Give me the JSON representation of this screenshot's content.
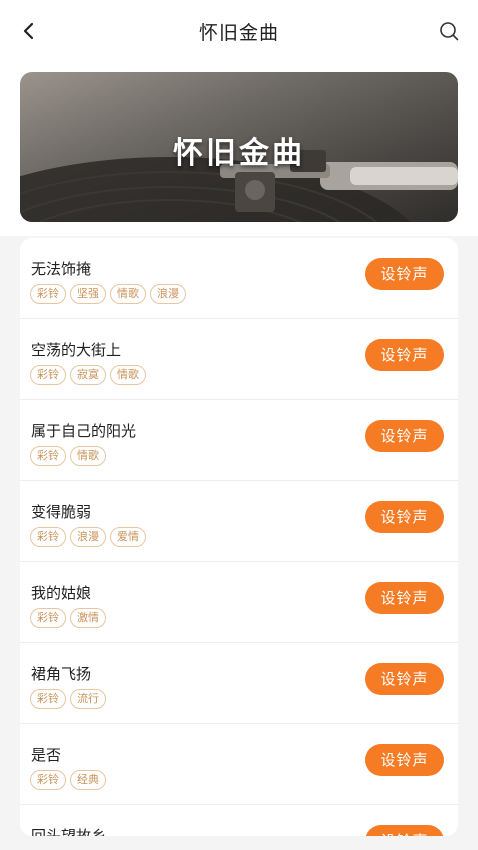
{
  "header": {
    "title": "怀旧金曲",
    "back_icon": "chevron-left-icon",
    "search_icon": "search-icon"
  },
  "banner": {
    "title": "怀旧金曲"
  },
  "colors": {
    "accent": "#f57c25",
    "tag_text": "#c9935a",
    "tag_border": "#e6c6a2"
  },
  "songs": [
    {
      "title": "无法饰掩",
      "tags": [
        "彩铃",
        "坚强",
        "情歌",
        "浪漫"
      ],
      "action": "设铃声"
    },
    {
      "title": "空荡的大街上",
      "tags": [
        "彩铃",
        "寂寞",
        "情歌"
      ],
      "action": "设铃声"
    },
    {
      "title": "属于自己的阳光",
      "tags": [
        "彩铃",
        "情歌"
      ],
      "action": "设铃声"
    },
    {
      "title": "变得脆弱",
      "tags": [
        "彩铃",
        "浪漫",
        "爱情"
      ],
      "action": "设铃声"
    },
    {
      "title": "我的姑娘",
      "tags": [
        "彩铃",
        "激情"
      ],
      "action": "设铃声"
    },
    {
      "title": "裙角飞扬",
      "tags": [
        "彩铃",
        "流行"
      ],
      "action": "设铃声"
    },
    {
      "title": "是否",
      "tags": [
        "彩铃",
        "经典"
      ],
      "action": "设铃声"
    },
    {
      "title": "回头望故乡",
      "tags": [],
      "action": "设铃声"
    }
  ]
}
